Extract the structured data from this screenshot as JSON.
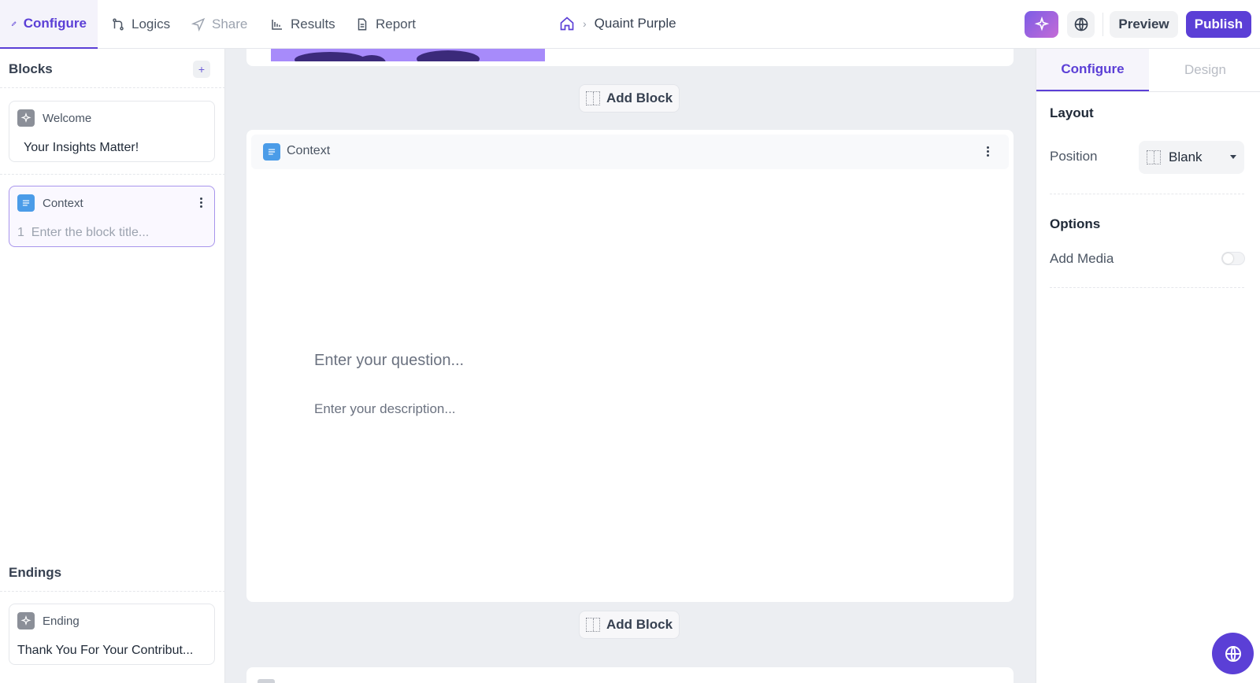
{
  "header": {
    "tabs": [
      {
        "label": "Configure",
        "icon": "pencil-icon",
        "state": "active"
      },
      {
        "label": "Logics",
        "icon": "git-branch-icon",
        "state": "normal"
      },
      {
        "label": "Share",
        "icon": "send-icon",
        "state": "disabled"
      },
      {
        "label": "Results",
        "icon": "bar-chart-icon",
        "state": "normal"
      },
      {
        "label": "Report",
        "icon": "document-icon",
        "state": "normal"
      }
    ],
    "breadcrumb": {
      "home_icon": "home-icon",
      "separator": "›",
      "current": "Quaint Purple"
    },
    "preview_label": "Preview",
    "publish_label": "Publish"
  },
  "sidebar": {
    "blocks_heading": "Blocks",
    "add_label": "+",
    "blocks": [
      {
        "type": "Welcome",
        "title": "Your Insights Matter!"
      },
      {
        "type": "Context",
        "number": "1",
        "placeholder": "Enter the block title..."
      }
    ],
    "endings_heading": "Endings",
    "endings": [
      {
        "type": "Ending",
        "title": "Thank You For Your Contribut..."
      }
    ]
  },
  "canvas": {
    "add_block_label": "Add Block",
    "block": {
      "type": "Context",
      "question_placeholder": "Enter your question...",
      "description_placeholder": "Enter your description..."
    }
  },
  "panel": {
    "tabs": [
      "Configure",
      "Design"
    ],
    "layout_heading": "Layout",
    "position_label": "Position",
    "position_value": "Blank",
    "options_heading": "Options",
    "add_media_label": "Add Media",
    "add_media_enabled": false
  },
  "colors": {
    "accent": "#5b3fd6",
    "context_badge": "#4b9ce8",
    "welcome_badge": "#8b8f98",
    "canvas_bg": "#eceef2"
  }
}
